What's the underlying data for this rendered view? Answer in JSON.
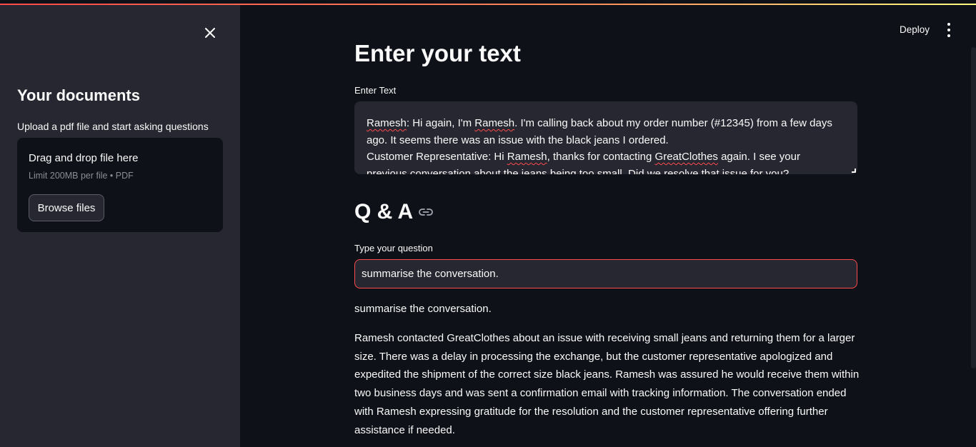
{
  "header": {
    "deploy_label": "Deploy",
    "menu_icon": "kebab-menu-icon"
  },
  "sidebar": {
    "close_icon": "close-icon",
    "title": "Your documents",
    "subtitle": "Upload a pdf file and start asking questions",
    "uploader": {
      "title": "Drag and drop file here",
      "limit": "Limit 200MB per file • PDF",
      "browse_label": "Browse files"
    }
  },
  "main": {
    "title": "Enter your text",
    "text_label": "Enter Text",
    "text_value_lines": [
      [
        "Ramesh",
        ": Hi again, I'm ",
        "Ramesh",
        ". I'm calling back about my order number (#12345) from a few days"
      ],
      [
        "ago. It seems there was an issue with the black jeans I ordered."
      ],
      [
        "Customer Representative: Hi ",
        "Ramesh",
        ", thanks for contacting ",
        "GreatClothes",
        " again. I see your"
      ],
      [
        "previous conversation about the jeans being too small. Did we resolve that issue for you?"
      ]
    ],
    "qa_title": "Q & A",
    "qa_link_icon": "link-icon",
    "question_label": "Type your question",
    "question_value": "summarise the conversation.",
    "question_echo": "summarise the conversation.",
    "answer": "Ramesh contacted GreatClothes about an issue with receiving small jeans and returning them for a larger size. There was a delay in processing the exchange, but the customer representative apologized and expedited the shipment of the correct size black jeans. Ramesh was assured he would receive them within two business days and was sent a confirmation email with tracking information. The conversation ended with Ramesh expressing gratitude for the resolution and the customer representative offering further assistance if needed."
  },
  "colors": {
    "background": "#0e1117",
    "sidebar": "#262730",
    "accent": "#ff4b4b",
    "text": "#fafafa"
  }
}
